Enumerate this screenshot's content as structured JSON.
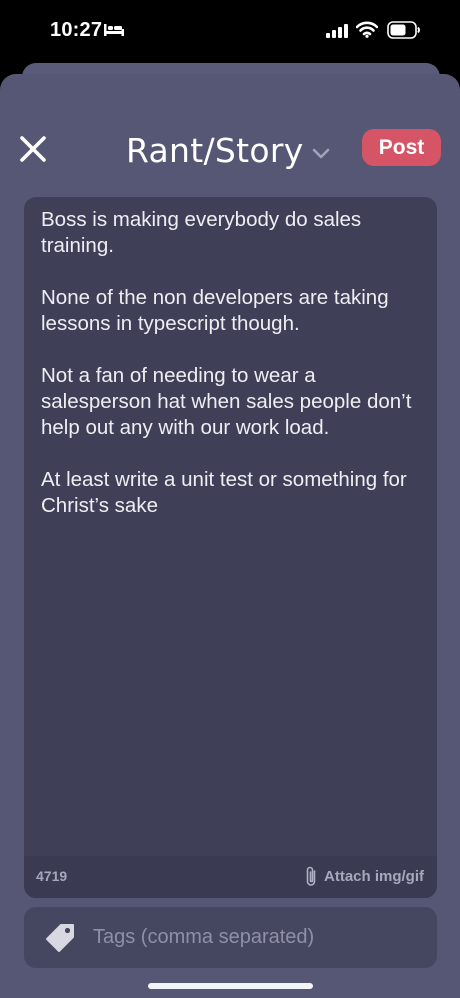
{
  "status_bar": {
    "time": "10:27",
    "icons": [
      "bed-icon",
      "signal-icon",
      "wifi-icon",
      "battery-icon"
    ]
  },
  "header": {
    "close_icon": "close-icon",
    "title": "Rant/Story",
    "dropdown_icon": "chevron-down-icon",
    "post_label": "Post",
    "post_color": "#d55465"
  },
  "editor": {
    "paragraphs": [
      "Boss is making everybody do sales training.",
      "None of the non developers are taking lessons in typescript though.",
      "Not a fan of needing to wear a salesperson hat when sales people don’t help out any with our work load.",
      "At least write a unit test or something for Christ’s sake"
    ],
    "char_count": "4719",
    "attach_icon": "paperclip-icon",
    "attach_label": "Attach img/gif"
  },
  "tags": {
    "icon": "tag-icon",
    "placeholder": "Tags (comma separated)",
    "value": ""
  },
  "colors": {
    "sheet": "#565774",
    "editor": "#3f4058",
    "accent": "#d55465"
  }
}
